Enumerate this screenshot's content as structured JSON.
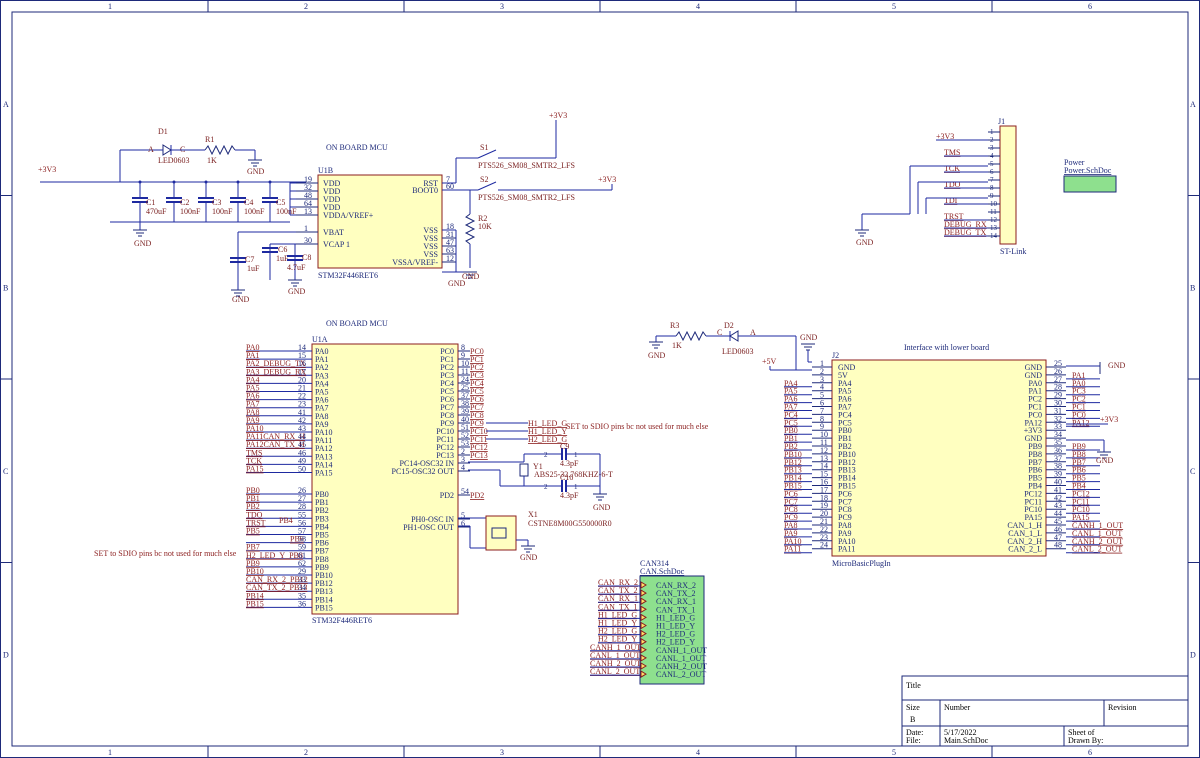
{
  "border": {
    "columns": [
      "1",
      "2",
      "3",
      "4",
      "5",
      "6"
    ],
    "rows": [
      "A",
      "B",
      "C",
      "D"
    ]
  },
  "power_labels": {
    "v33_left": "+3V3",
    "v33_top": "+3V3",
    "v33_mid": "+3V3",
    "v33_stlink": "+3V3",
    "v33_j2": "+3V3",
    "v5": "+5V",
    "gnd": "GND"
  },
  "mcu_b": {
    "section_title": "ON BOARD MCU",
    "ref": "U1B",
    "part": "STM32F446RET6",
    "pins_left": [
      {
        "num": "19",
        "name": "VDD"
      },
      {
        "num": "32",
        "name": "VDD"
      },
      {
        "num": "48",
        "name": "VDD"
      },
      {
        "num": "64",
        "name": "VDD"
      },
      {
        "num": "13",
        "name": "VDDA/VREF+"
      },
      {
        "num": "1",
        "name": "VBAT"
      },
      {
        "num": "30",
        "name": "VCAP 1"
      }
    ],
    "pins_right": [
      {
        "num": "7",
        "name": "RST"
      },
      {
        "num": "60",
        "name": "BOOT0"
      },
      {
        "num": "18",
        "name": "VSS"
      },
      {
        "num": "31",
        "name": "VSS"
      },
      {
        "num": "47",
        "name": "VSS"
      },
      {
        "num": "63",
        "name": "VSS"
      },
      {
        "num": "12",
        "name": "VSSA/VREF-"
      }
    ]
  },
  "passives": {
    "d1": {
      "ref": "D1",
      "part": "LED0603",
      "a": "A",
      "c": "C"
    },
    "r1": {
      "ref": "R1",
      "value": "1K"
    },
    "caps": [
      {
        "ref": "C1",
        "value": "470uF"
      },
      {
        "ref": "C2",
        "value": "100nF"
      },
      {
        "ref": "C3",
        "value": "100nF"
      },
      {
        "ref": "C4",
        "value": "100nF"
      },
      {
        "ref": "C5",
        "value": "100nF"
      },
      {
        "ref": "C7",
        "value": "1uF"
      },
      {
        "ref": "C6",
        "value": "1uF"
      },
      {
        "ref": "C8",
        "value": "4.7uF"
      }
    ],
    "s1": {
      "ref": "S1",
      "part": "PTS526_SM08_SMTR2_LFS"
    },
    "s2": {
      "ref": "S2",
      "part": "PTS526_SM08_SMTR2_LFS"
    },
    "r2": {
      "ref": "R2",
      "value": "10K"
    },
    "r3": {
      "ref": "R3",
      "value": "1K"
    },
    "d2": {
      "ref": "D2",
      "part": "LED0603",
      "c": "C",
      "a": "A"
    },
    "y1": {
      "ref": "Y1",
      "part": "ABS25-32.768KHZ-6-T"
    },
    "c9": {
      "ref": "C9",
      "value": "4.3pF"
    },
    "c10": {
      "ref": "C10",
      "value": "4.3pF"
    },
    "x1": {
      "ref": "X1",
      "part": "CSTNE8M00G550000R0"
    }
  },
  "stlink": {
    "ref": "J1",
    "name": "ST-Link",
    "nets": [
      "+3V3",
      "TMS",
      "TCK",
      "TDO",
      "TDI",
      "TRST",
      "DEBUG_RX",
      "DEBUG_TX"
    ],
    "pins": [
      "1",
      "2",
      "3",
      "4",
      "5",
      "6",
      "7",
      "8",
      "9",
      "10",
      "11",
      "12",
      "13",
      "14"
    ]
  },
  "power_sheet": {
    "title": "Power",
    "file": "Power.SchDoc"
  },
  "mcu_a": {
    "section_title": "ON BOARD MCU",
    "ref": "U1A",
    "part": "STM32F446RET6",
    "left_a": [
      {
        "net": "PA0",
        "num": "14",
        "name": "PA0"
      },
      {
        "net": "PA1",
        "num": "15",
        "name": "PA1"
      },
      {
        "net": "PA2_DEBUG_TX",
        "num": "16",
        "name": "PA2"
      },
      {
        "net": "PA3_DEBUG_RX",
        "num": "17",
        "name": "PA3"
      },
      {
        "net": "PA4",
        "num": "20",
        "name": "PA4"
      },
      {
        "net": "PA5",
        "num": "21",
        "name": "PA5"
      },
      {
        "net": "PA6",
        "num": "22",
        "name": "PA6"
      },
      {
        "net": "PA7",
        "num": "23",
        "name": "PA7"
      },
      {
        "net": "PA8",
        "num": "41",
        "name": "PA8"
      },
      {
        "net": "PA9",
        "num": "42",
        "name": "PA9"
      },
      {
        "net": "PA10",
        "num": "43",
        "name": "PA10"
      },
      {
        "net": "PA11CAN_RX_H",
        "num": "44",
        "name": "PA11"
      },
      {
        "net": "PA12CAN_TX_H",
        "num": "45",
        "name": "PA12"
      },
      {
        "net": "TMS",
        "num": "46",
        "name": "PA13"
      },
      {
        "net": "TCK",
        "num": "49",
        "name": "PA14"
      },
      {
        "net": "PA15",
        "num": "50",
        "name": "PA15"
      }
    ],
    "left_b": [
      {
        "net": "PB0",
        "num": "26",
        "name": "PB0"
      },
      {
        "net": "PB1",
        "num": "27",
        "name": "PB1"
      },
      {
        "net": "PB2",
        "num": "28",
        "name": "PB2"
      },
      {
        "net": "TDO",
        "num": "55",
        "name": "PB3"
      },
      {
        "net": "TRST",
        "num": "56",
        "name": "PB4"
      },
      {
        "net": "PB5",
        "num": "57",
        "name": "PB5"
      },
      {
        "net": "PB6",
        "num": "58",
        "name": "PB6"
      },
      {
        "net": "PB7",
        "num": "59",
        "name": "PB7"
      },
      {
        "net": "H2_LED_Y_PB8",
        "num": "61",
        "name": "PB8"
      },
      {
        "net": "PB9",
        "num": "62",
        "name": "PB9"
      },
      {
        "net": "PB10",
        "num": "29",
        "name": "PB10"
      },
      {
        "net": "CAN_RX_2_PB12",
        "num": "33",
        "name": "PB12"
      },
      {
        "net": "CAN_TX_2_PB13",
        "num": "34",
        "name": "PB13"
      },
      {
        "net": "PB14",
        "num": "35",
        "name": "PB14"
      },
      {
        "net": "PB15",
        "num": "36",
        "name": "PB15"
      }
    ],
    "pb4_tag": "PB4",
    "right": [
      {
        "name": "PC0",
        "num": "8",
        "net": "PC0"
      },
      {
        "name": "PC1",
        "num": "9",
        "net": "PC1"
      },
      {
        "name": "PC2",
        "num": "10",
        "net": "PC2"
      },
      {
        "name": "PC3",
        "num": "11",
        "net": "PC3"
      },
      {
        "name": "PC4",
        "num": "24",
        "net": "PC4"
      },
      {
        "name": "PC5",
        "num": "25",
        "net": "PC5"
      },
      {
        "name": "PC6",
        "num": "37",
        "net": "PC6"
      },
      {
        "name": "PC7",
        "num": "38",
        "net": "PC7"
      },
      {
        "name": "PC8",
        "num": "39",
        "net": "PC8"
      },
      {
        "name": "PC9",
        "num": "40",
        "net": "PC9"
      },
      {
        "name": "PC10",
        "num": "51",
        "net": "PC10"
      },
      {
        "name": "PC11",
        "num": "52",
        "net": "PC11"
      },
      {
        "name": "PC12",
        "num": "53",
        "net": "PC12"
      },
      {
        "name": "PC13",
        "num": "2",
        "net": "PC13"
      },
      {
        "name": "PC14-OSC32 IN",
        "num": "3",
        "net": ""
      },
      {
        "name": "PC15-OSC32 OUT",
        "num": "4",
        "net": ""
      },
      {
        "name": "PD2",
        "num": "54",
        "net": "PD2"
      },
      {
        "name": "PH0-OSC IN",
        "num": "5",
        "net": ""
      },
      {
        "name": "PH1-OSC OUT",
        "num": "6",
        "net": ""
      }
    ],
    "led_nets": [
      "H1_LED_G",
      "H1_LED_Y",
      "H2_LED_G"
    ],
    "note_right": "SET to SDIO pins bc not used for much else",
    "note_left": "SET to SDIO pins bc not used for much else"
  },
  "can_sheet": {
    "title": "CAN314",
    "file": "CAN.SchDoc",
    "ports": [
      "CAN_RX_2",
      "CAN_TX_2",
      "CAN_RX_1",
      "CAN_TX_1",
      "H1_LED_G",
      "H1_LED_Y",
      "H2_LED_G",
      "H2_LED_Y",
      "CANH_1_OUT",
      "CANL_1_OUT",
      "CANH_2_OUT",
      "CANL_2_OUT"
    ]
  },
  "j2": {
    "ref": "J2",
    "part": "MicroBasicPlugIn",
    "title": "Interface with lower board",
    "left": [
      {
        "net": "",
        "num": "1",
        "name": "GND"
      },
      {
        "net": "",
        "num": "2",
        "name": "5V"
      },
      {
        "net": "PA4",
        "num": "3",
        "name": "PA4"
      },
      {
        "net": "PA5",
        "num": "4",
        "name": "PA5"
      },
      {
        "net": "PA6",
        "num": "5",
        "name": "PA6"
      },
      {
        "net": "PA7",
        "num": "6",
        "name": "PA7"
      },
      {
        "net": "PC4",
        "num": "7",
        "name": "PC4"
      },
      {
        "net": "PC5",
        "num": "8",
        "name": "PC5"
      },
      {
        "net": "PB0",
        "num": "9",
        "name": "PB0"
      },
      {
        "net": "PB1",
        "num": "10",
        "name": "PB1"
      },
      {
        "net": "PB2",
        "num": "11",
        "name": "PB2"
      },
      {
        "net": "PB10",
        "num": "12",
        "name": "PB10"
      },
      {
        "net": "PB12",
        "num": "13",
        "name": "PB12"
      },
      {
        "net": "PB13",
        "num": "14",
        "name": "PB13"
      },
      {
        "net": "PB14",
        "num": "15",
        "name": "PB14"
      },
      {
        "net": "PB15",
        "num": "16",
        "name": "PB15"
      },
      {
        "net": "PC6",
        "num": "17",
        "name": "PC6"
      },
      {
        "net": "PC7",
        "num": "18",
        "name": "PC7"
      },
      {
        "net": "PC8",
        "num": "19",
        "name": "PC8"
      },
      {
        "net": "PC9",
        "num": "20",
        "name": "PC9"
      },
      {
        "net": "PA8",
        "num": "21",
        "name": "PA8"
      },
      {
        "net": "PA9",
        "num": "22",
        "name": "PA9"
      },
      {
        "net": "PA10",
        "num": "23",
        "name": "PA10"
      },
      {
        "net": "PA11",
        "num": "24",
        "name": "PA11"
      }
    ],
    "right": [
      {
        "name": "GND",
        "num": "25",
        "net": ""
      },
      {
        "name": "GND",
        "num": "26",
        "net": "PA1"
      },
      {
        "name": "PA0",
        "num": "27",
        "net": "PA0"
      },
      {
        "name": "PA1",
        "num": "28",
        "net": "PC3"
      },
      {
        "name": "PC2",
        "num": "29",
        "net": "PC2"
      },
      {
        "name": "PC1",
        "num": "30",
        "net": "PC1"
      },
      {
        "name": "PC0",
        "num": "31",
        "net": "PC0"
      },
      {
        "name": "PA12",
        "num": "32",
        "net": "PA12"
      },
      {
        "name": "+3V3",
        "num": "33",
        "net": ""
      },
      {
        "name": "GND",
        "num": "34",
        "net": ""
      },
      {
        "name": "PB9",
        "num": "35",
        "net": "PB9"
      },
      {
        "name": "PB8",
        "num": "36",
        "net": "PB8"
      },
      {
        "name": "PB7",
        "num": "37",
        "net": "PB7"
      },
      {
        "name": "PB6",
        "num": "38",
        "net": "PB6"
      },
      {
        "name": "PB5",
        "num": "39",
        "net": "PB5"
      },
      {
        "name": "PB4",
        "num": "40",
        "net": "PB4"
      },
      {
        "name": "PC12",
        "num": "41",
        "net": "PC12"
      },
      {
        "name": "PC11",
        "num": "42",
        "net": "PC11"
      },
      {
        "name": "PC10",
        "num": "43",
        "net": "PC10"
      },
      {
        "name": "PA15",
        "num": "44",
        "net": "PA15"
      },
      {
        "name": "CAN_1_H",
        "num": "45",
        "net": "CANH_1_OUT"
      },
      {
        "name": "CAN_1_L",
        "num": "46",
        "net": "CANL_1_OUT"
      },
      {
        "name": "CAN_2_H",
        "num": "47",
        "net": "CANH_2_OUT"
      },
      {
        "name": "CAN_2_L",
        "num": "48",
        "net": "CANL_2_OUT"
      }
    ]
  },
  "title_block": {
    "title_label": "Title",
    "size_label": "Size",
    "size_value": "B",
    "number_label": "Number",
    "revision_label": "Revision",
    "date_label": "Date:",
    "date_value": "5/17/2022",
    "file_label": "File:",
    "file_value": "Main.SchDoc",
    "sheet_label": "Sheet of",
    "drawn_label": "Drawn By:"
  }
}
